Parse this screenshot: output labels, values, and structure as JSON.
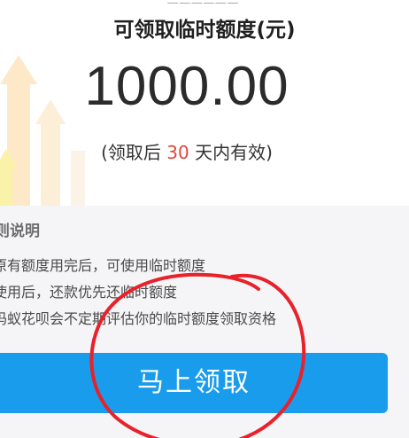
{
  "header": {
    "title": "可领取临时额度(元)",
    "amount": "1000.00",
    "validity_prefix": "(领取后 ",
    "validity_days": "30",
    "validity_suffix": " 天内有效)"
  },
  "rules": {
    "title": "则说明",
    "items": [
      "原有额度用完后，可使用临时额度",
      "使用后，还款优先还临时额度",
      "妈蚁花呗会不定期评估你的临时额度领取资格"
    ]
  },
  "action": {
    "claim_label": "马上领取"
  },
  "colors": {
    "accent_blue": "#1a9cec",
    "highlight_red": "#e0473b",
    "annotation_red": "#e8212a"
  }
}
